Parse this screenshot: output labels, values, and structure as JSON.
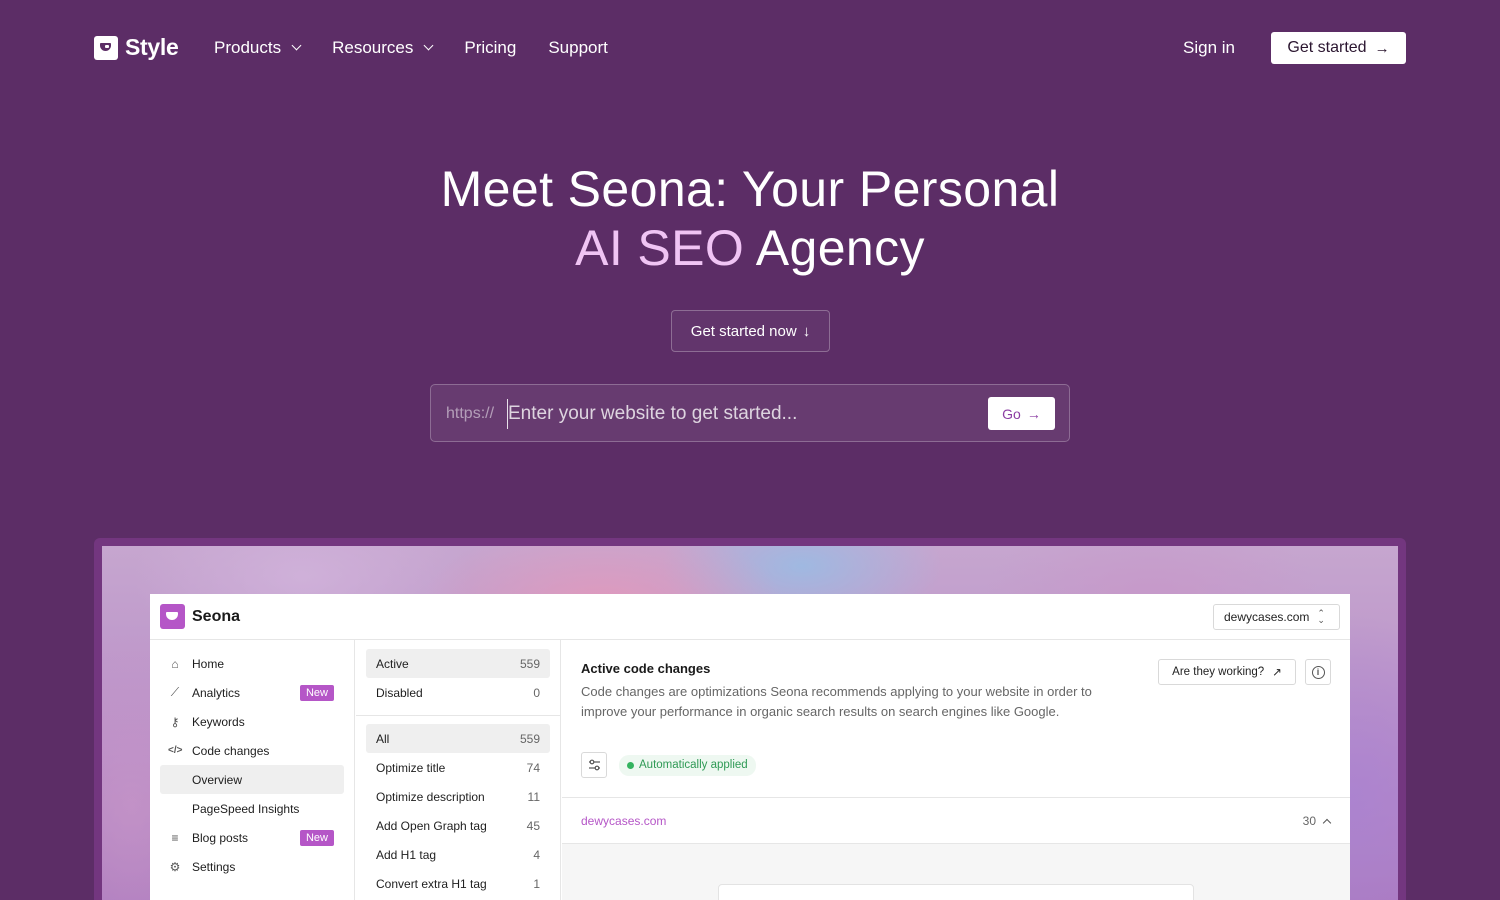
{
  "nav": {
    "logo_text": "Style",
    "links": [
      {
        "label": "Products",
        "dropdown": true
      },
      {
        "label": "Resources",
        "dropdown": true
      },
      {
        "label": "Pricing",
        "dropdown": false
      },
      {
        "label": "Support",
        "dropdown": false
      }
    ],
    "sign_in": "Sign in",
    "cta_label": "Get started",
    "cta_arrow": "→"
  },
  "hero": {
    "title_line1": "Meet Seona: Your Personal",
    "title_accent": "AI SEO",
    "title_line2_rest": " Agency",
    "cta_label": "Get started now",
    "cta_arrow": "↓",
    "url_prefix": "https://",
    "url_placeholder": "Enter your website to get started...",
    "go_label": "Go",
    "go_arrow": "→"
  },
  "app": {
    "logo_text": "Seona",
    "domain_select": "dewycases.com",
    "sidebar": [
      {
        "icon": "home-icon",
        "glyph": "⌂",
        "label": "Home",
        "badge": ""
      },
      {
        "icon": "chart-icon",
        "glyph": "⟋",
        "label": "Analytics",
        "badge": "New"
      },
      {
        "icon": "key-icon",
        "glyph": "⚷",
        "label": "Keywords",
        "badge": ""
      },
      {
        "icon": "code-icon",
        "glyph": "</>",
        "label": "Code changes",
        "badge": ""
      },
      {
        "icon": "",
        "glyph": "",
        "label": "Overview",
        "badge": "",
        "sub": true,
        "active": true
      },
      {
        "icon": "",
        "glyph": "",
        "label": "PageSpeed Insights",
        "badge": "",
        "sub": true
      },
      {
        "icon": "list-icon",
        "glyph": "≡",
        "label": "Blog posts",
        "badge": "New"
      },
      {
        "icon": "gear-icon",
        "glyph": "⚙",
        "label": "Settings",
        "badge": ""
      }
    ],
    "status_filters": [
      {
        "label": "Active",
        "count": "559",
        "selected": true
      },
      {
        "label": "Disabled",
        "count": "0",
        "selected": false
      }
    ],
    "type_filters": [
      {
        "label": "All",
        "count": "559",
        "selected": true
      },
      {
        "label": "Optimize title",
        "count": "74",
        "selected": false
      },
      {
        "label": "Optimize description",
        "count": "11",
        "selected": false
      },
      {
        "label": "Add Open Graph tag",
        "count": "45",
        "selected": false
      },
      {
        "label": "Add H1 tag",
        "count": "4",
        "selected": false
      },
      {
        "label": "Convert extra H1 tag",
        "count": "1",
        "selected": false
      }
    ],
    "main": {
      "title": "Active code changes",
      "description": "Code changes are optimizations Seona recommends applying to your website in order to improve your performance in organic search results on search engines like Google.",
      "working_button": "Are they working?",
      "working_arrow": "↗",
      "info_glyph": "i",
      "auto_badge": "Automatically applied",
      "domain_row": "dewycases.com",
      "domain_count": "30"
    }
  },
  "colors": {
    "background": "#5c2d66",
    "accent_text": "#f0c4f4",
    "brand": "#b556c7",
    "success": "#34b35f"
  }
}
